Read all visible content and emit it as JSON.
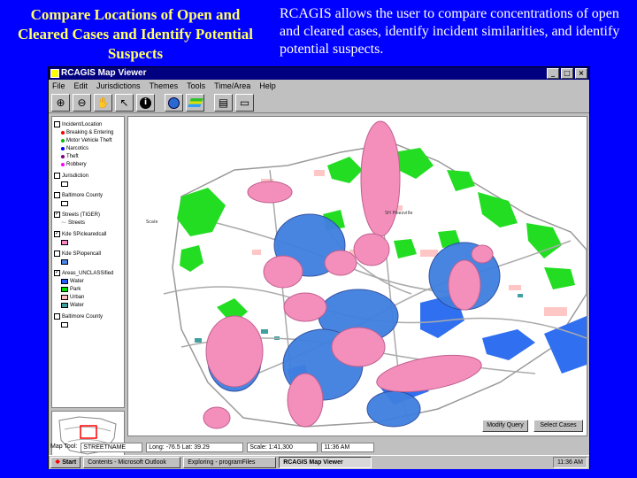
{
  "slide": {
    "title": "Compare Locations of Open and Cleared Cases and Identify Potential Suspects",
    "description": "RCAGIS allows the user to compare concentrations of open and cleared cases, identify incident similarities, and identify potential suspects."
  },
  "window": {
    "title": "RCAGIS Map Viewer",
    "menu": [
      "File",
      "Edit",
      "Jurisdictions",
      "Themes",
      "Tools",
      "Time/Area",
      "Help"
    ]
  },
  "toolbar": [
    "zoom-in-icon",
    "zoom-out-icon",
    "pan-hand-icon",
    "select-arrow-icon",
    "info-icon",
    "globe-icon",
    "layers-icon",
    "print-icon",
    "open-file-icon"
  ],
  "legend": {
    "groups": [
      {
        "label": "Incident/Location",
        "checked": false,
        "items": [
          {
            "label": "Breaking & Entering",
            "color": "#ff0000"
          },
          {
            "label": "Motor Vehicle Theft",
            "color": "#00c000"
          },
          {
            "label": "Narcotics",
            "color": "#0000ff"
          },
          {
            "label": "Theft",
            "color": "#800080"
          },
          {
            "label": "Robbery",
            "color": "#ff00ff"
          }
        ]
      },
      {
        "label": "Jurisdiction",
        "checked": false,
        "items": []
      },
      {
        "label": "Baltimore County",
        "checked": false,
        "items": []
      },
      {
        "label": "Streets (TIGER)",
        "checked": true,
        "items": [
          {
            "label": "Streets",
            "color": "#808080"
          }
        ]
      },
      {
        "label": "Kde SPiclearedcall",
        "checked": true,
        "items": [
          {
            "label": "",
            "color": "#ff88c8"
          }
        ]
      },
      {
        "label": "Kde SPiopencall",
        "checked": false,
        "items": [
          {
            "label": "",
            "color": "#4a86e8"
          }
        ]
      },
      {
        "label": "Areas_UNCLASSified",
        "checked": true,
        "items": [
          {
            "label": "Water",
            "color": "#2060ff"
          },
          {
            "label": "Park",
            "color": "#00e000"
          },
          {
            "label": "Urban",
            "color": "#ffc0c0"
          },
          {
            "label": "Water",
            "color": "#40a0a0"
          }
        ]
      },
      {
        "label": "Baltimore County",
        "checked": false,
        "items": []
      }
    ]
  },
  "status": {
    "map_label": "Map Tool:",
    "map_value": "STREETNAME",
    "coords": "Long: -76.5  Lat: 39.29",
    "scale": "Scale: 1:41,300",
    "time": "11:36 AM"
  },
  "buttons": {
    "modify": "Modify Query",
    "select": "Select Cases"
  },
  "taskbar": {
    "start": "Start",
    "tasks": [
      "Contents - Microsoft Outlook",
      "Exploring - programFiles",
      "RCAGIS Map Viewer"
    ],
    "clock": "11:36 AM"
  },
  "map": {
    "cleared_color": "#f48fbc",
    "open_color": "#3f7fe0",
    "park_color": "#22dd22",
    "water_color": "#2f6ff0"
  }
}
